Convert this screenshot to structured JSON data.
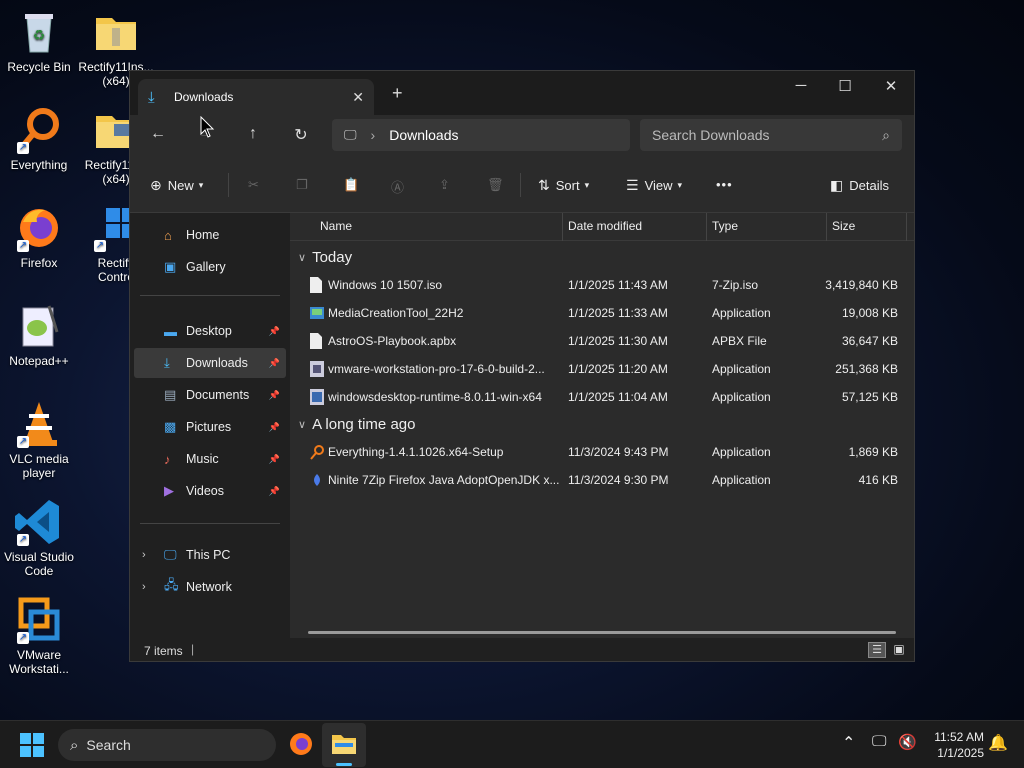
{
  "desktop": {
    "icons": [
      {
        "label": "Recycle Bin",
        "icon": "recycle-bin-icon"
      },
      {
        "label": "Rectify11Ins... (x64)",
        "icon": "folder-icon"
      },
      {
        "label": "Everything",
        "icon": "everything-search-icon"
      },
      {
        "label": "Rectify11I... (x64)",
        "icon": "folder-icon"
      },
      {
        "label": "Firefox",
        "icon": "firefox-icon"
      },
      {
        "label": "Rectify Contro",
        "icon": "control-panel-icon"
      },
      {
        "label": "Notepad++",
        "icon": "notepadpp-icon"
      },
      {
        "label": "VLC media player",
        "icon": "vlc-icon"
      },
      {
        "label": "Visual Studio Code",
        "icon": "vscode-icon"
      },
      {
        "label": "VMware Workstati...",
        "icon": "vmware-icon"
      }
    ]
  },
  "window": {
    "tab_title": "Downloads",
    "new_tab": "+",
    "controls": {
      "minimize": "─",
      "maximize": "☐",
      "close": "✕"
    },
    "address": {
      "location": "Downloads"
    },
    "search": {
      "placeholder": "Search Downloads"
    },
    "commands": {
      "new": "New",
      "sort": "Sort",
      "view": "View",
      "more": "•••",
      "details": "Details"
    },
    "sidebar": {
      "home": "Home",
      "gallery": "Gallery",
      "pinned": [
        {
          "label": "Desktop",
          "icon": "desktop-folder-icon"
        },
        {
          "label": "Downloads",
          "icon": "downloads-folder-icon"
        },
        {
          "label": "Documents",
          "icon": "documents-folder-icon"
        },
        {
          "label": "Pictures",
          "icon": "pictures-folder-icon"
        },
        {
          "label": "Music",
          "icon": "music-folder-icon"
        },
        {
          "label": "Videos",
          "icon": "videos-folder-icon"
        }
      ],
      "this_pc": "This PC",
      "network": "Network"
    },
    "columns": {
      "name": "Name",
      "date": "Date modified",
      "type": "Type",
      "size": "Size"
    },
    "groups": [
      {
        "label": "Today",
        "files": [
          {
            "name": "Windows 10 1507.iso",
            "date": "1/1/2025 11:43 AM",
            "type": "7-Zip.iso",
            "size": "3,419,840 KB"
          },
          {
            "name": "MediaCreationTool_22H2",
            "date": "1/1/2025 11:33 AM",
            "type": "Application",
            "size": "19,008 KB"
          },
          {
            "name": "AstroOS-Playbook.apbx",
            "date": "1/1/2025 11:30 AM",
            "type": "APBX File",
            "size": "36,647 KB"
          },
          {
            "name": "vmware-workstation-pro-17-6-0-build-2...",
            "date": "1/1/2025 11:20 AM",
            "type": "Application",
            "size": "251,368 KB"
          },
          {
            "name": "windowsdesktop-runtime-8.0.11-win-x64",
            "date": "1/1/2025 11:04 AM",
            "type": "Application",
            "size": "57,125 KB"
          }
        ]
      },
      {
        "label": "A long time ago",
        "files": [
          {
            "name": "Everything-1.4.1.1026.x64-Setup",
            "date": "11/3/2024 9:43 PM",
            "type": "Application",
            "size": "1,869 KB"
          },
          {
            "name": "Ninite 7Zip Firefox Java AdoptOpenJDK x...",
            "date": "11/3/2024 9:30 PM",
            "type": "Application",
            "size": "416 KB"
          }
        ]
      }
    ],
    "status": {
      "items": "7 items"
    }
  },
  "taskbar": {
    "search": "Search",
    "time": "11:52 AM",
    "date": "1/1/2025"
  },
  "colors": {
    "accent": "#4cc2ff",
    "window_bg": "#202020",
    "panel_bg": "#2b2b2b"
  }
}
